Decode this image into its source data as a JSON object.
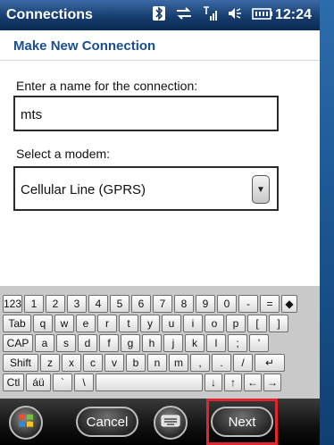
{
  "status": {
    "title": "Connections",
    "time": "12:24",
    "icons": [
      "bluetooth-icon",
      "sync-icon",
      "signal-icon",
      "volume-icon",
      "battery-icon"
    ]
  },
  "header": {
    "title": "Make New Connection"
  },
  "form": {
    "name_label": "Enter a name for the connection:",
    "name_value": "mts",
    "modem_label": "Select a modem:",
    "modem_value": "Cellular Line (GPRS)"
  },
  "keyboard": {
    "rows": [
      [
        "123",
        "1",
        "2",
        "3",
        "4",
        "5",
        "6",
        "7",
        "8",
        "9",
        "0",
        "-",
        "=",
        "◆"
      ],
      [
        "Tab",
        "q",
        "w",
        "e",
        "r",
        "t",
        "y",
        "u",
        "i",
        "o",
        "p",
        "[",
        "]"
      ],
      [
        "CAP",
        "a",
        "s",
        "d",
        "f",
        "g",
        "h",
        "j",
        "k",
        "l",
        ";",
        "'"
      ],
      [
        "Shift",
        "z",
        "x",
        "c",
        "v",
        "b",
        "n",
        "m",
        ",",
        ".",
        "/",
        "↵"
      ],
      [
        "Ctl",
        "áü",
        "`",
        "\\",
        " ",
        "↓",
        "↑",
        "←",
        "→"
      ]
    ]
  },
  "bottom": {
    "cancel_label": "Cancel",
    "next_label": "Next"
  },
  "colors": {
    "accent": "#1b4e8e",
    "highlight": "#e0262f"
  }
}
